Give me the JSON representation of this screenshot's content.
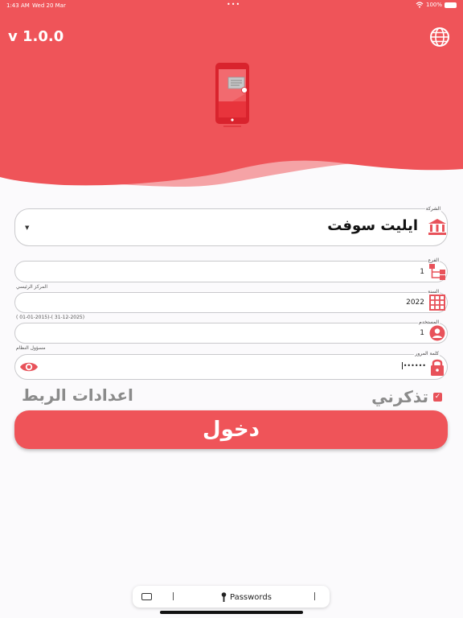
{
  "status_bar": {
    "time": "1:43 AM",
    "date": "Wed 20 Mar",
    "battery": "100%"
  },
  "header": {
    "version": "v 1.0.0",
    "language_icon": "globe-icon",
    "logo_icon": "phone-receipt-logo"
  },
  "colors": {
    "primary": "#ef5459",
    "wave_light": "#f5a3a6",
    "background": "#fbfafc",
    "muted_text": "#8b8b8b"
  },
  "form": {
    "company": {
      "label": "الشركة",
      "value": "ايليت سوفت",
      "icon": "bank-icon"
    },
    "branch": {
      "label": "الفرع",
      "value": "1",
      "hint": "المركز الرئيسي",
      "icon": "hierarchy-icon"
    },
    "year": {
      "label": "السنة",
      "value": "2022",
      "hint": "( 01-01-2015)-( 31-12-2025)",
      "icon": "grid-icon"
    },
    "user": {
      "label": "المستخدم",
      "value": "1",
      "hint": "مسؤول النظام",
      "icon": "person-icon"
    },
    "password": {
      "label": "كلمة المرور",
      "value": "••••••",
      "icon": "lock-icon",
      "toggle_icon": "eye-icon"
    },
    "remember_me": {
      "label": "تذكرني",
      "checked": true
    },
    "connection_settings": "اعدادات الربط",
    "login_button": "دخول"
  },
  "keyboard_bar": {
    "passwords_label": "Passwords",
    "icon": "key-icon"
  }
}
